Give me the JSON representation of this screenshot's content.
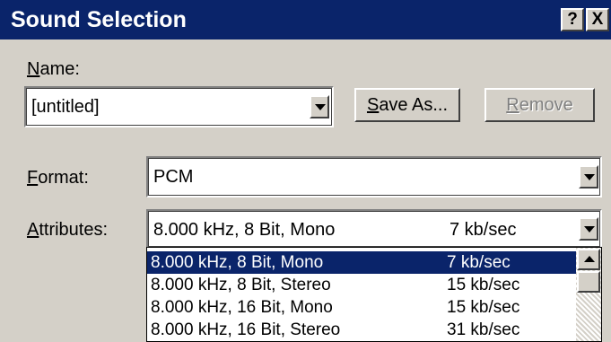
{
  "window": {
    "title": "Sound Selection",
    "help_label": "?",
    "close_label": "X"
  },
  "name_field": {
    "label_mnemonic": "N",
    "label_rest": "ame:",
    "value": "[untitled]"
  },
  "buttons": {
    "save_as_mnemonic": "S",
    "save_as_rest": "ave As...",
    "remove_mnemonic": "R",
    "remove_rest": "emove"
  },
  "format_field": {
    "label_mnemonic": "F",
    "label_rest": "ormat:",
    "value": "PCM"
  },
  "attributes_field": {
    "label_mnemonic": "A",
    "label_rest": "ttributes:",
    "value_name": "8.000 kHz, 8 Bit, Mono",
    "value_rate": "7 kb/sec"
  },
  "attributes_list": {
    "items": [
      {
        "name": "8.000 kHz, 8 Bit, Mono",
        "rate": "7 kb/sec",
        "selected": true
      },
      {
        "name": "8.000 kHz, 8 Bit, Stereo",
        "rate": "15 kb/sec",
        "selected": false
      },
      {
        "name": "8.000 kHz, 16 Bit, Mono",
        "rate": "15 kb/sec",
        "selected": false
      },
      {
        "name": "8.000 kHz, 16 Bit, Stereo",
        "rate": "31 kb/sec",
        "selected": false
      }
    ]
  },
  "colors": {
    "titlebar": "#0a246a",
    "selection": "#0a246a",
    "face": "#d4d0c8"
  },
  "icons": {
    "dropdown": "chevron-down-icon",
    "scroll_up": "arrow-up-icon"
  }
}
